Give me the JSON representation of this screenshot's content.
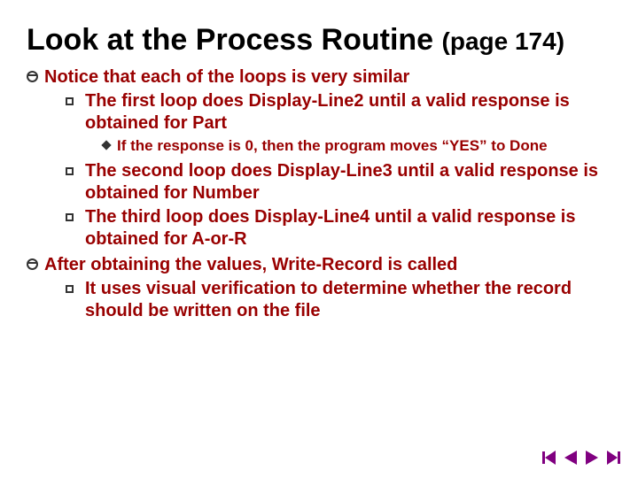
{
  "title_main": "Look at the Process Routine ",
  "title_sub": "(page 174)",
  "bullets": {
    "b1": "Notice that each of the loops is very similar",
    "b1a": "The first loop does Display-Line2 until a valid response is obtained for Part",
    "b1a_i": "If the response is 0, then the program moves “YES” to Done",
    "b1b": "The second loop does Display-Line3 until a valid response is obtained for Number",
    "b1c": "The third loop does Display-Line4 until a valid response is obtained for A-or-R",
    "b2": "After obtaining the values, Write-Record is called",
    "b2a": "It uses visual verification to determine whether the record should be written on the file"
  }
}
